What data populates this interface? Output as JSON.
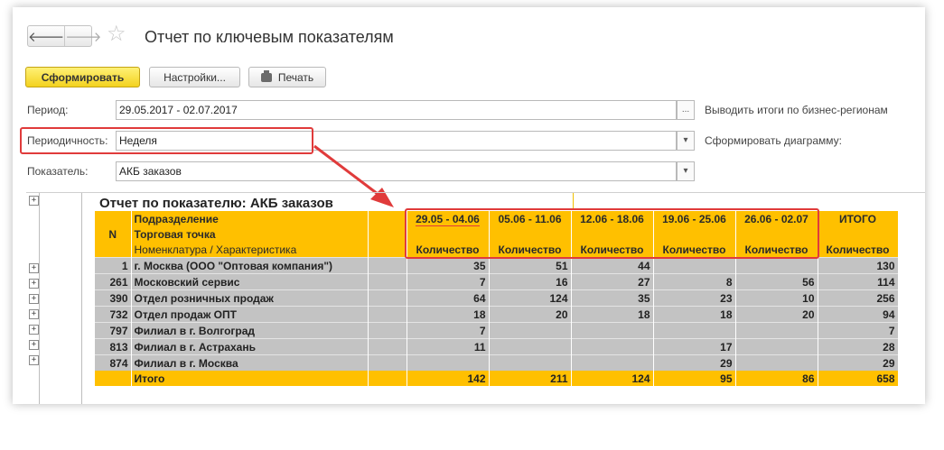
{
  "window": {
    "title": "Отчет по ключевым показателям",
    "nav": {
      "back": "🡐",
      "forward": "🡒"
    },
    "star": "☆"
  },
  "toolbar": {
    "generate_label": "Сформировать",
    "settings_label": "Настройки...",
    "print_label": "Печать"
  },
  "form": {
    "period_label": "Период:",
    "period_value": "29.05.2017 - 02.07.2017",
    "period_btn": "...",
    "periodicity_label": "Периодичность:",
    "periodicity_value": "Неделя",
    "indicator_label": "Показатель:",
    "indicator_value": "АКБ заказов",
    "dropdown_glyph": "▾",
    "side_option_1": "Выводить итоги по бизнес-регионам",
    "side_option_2": "Сформировать диаграмму:"
  },
  "report": {
    "title": "Отчет по показателю: АКБ заказов",
    "expand_glyph": "+",
    "header": {
      "n": "N",
      "level1": "Подразделение",
      "level2": "Торговая точка",
      "level3": "Номенклатура / Характеристика",
      "periods": [
        "29.05 - 04.06",
        "05.06 - 11.06",
        "12.06 - 18.06",
        "19.06 - 25.06",
        "26.06 - 02.07"
      ],
      "total": "ИТОГО",
      "qty": "Количество"
    },
    "rows": [
      {
        "n": "1",
        "name": "г. Москва  (ООО \"Оптовая компания\")",
        "v": [
          "35",
          "51",
          "44",
          "",
          ""
        ],
        "total": "130"
      },
      {
        "n": "261",
        "name": "Московский сервис",
        "v": [
          "7",
          "16",
          "27",
          "8",
          "56"
        ],
        "total": "114"
      },
      {
        "n": "390",
        "name": "Отдел розничных продаж",
        "v": [
          "64",
          "124",
          "35",
          "23",
          "10"
        ],
        "total": "256"
      },
      {
        "n": "732",
        "name": "Отдел продаж ОПТ",
        "v": [
          "18",
          "20",
          "18",
          "18",
          "20"
        ],
        "total": "94"
      },
      {
        "n": "797",
        "name": "Филиал в г. Волгоград",
        "v": [
          "7",
          "",
          "",
          "",
          ""
        ],
        "total": "7"
      },
      {
        "n": "813",
        "name": "Филиал в г. Астрахань",
        "v": [
          "11",
          "",
          "",
          "17",
          ""
        ],
        "total": "28"
      },
      {
        "n": "874",
        "name": "Филиал в г. Москва",
        "v": [
          "",
          "",
          "",
          "29",
          ""
        ],
        "total": "29"
      }
    ],
    "totals": {
      "label": "Итого",
      "v": [
        "142",
        "211",
        "124",
        "95",
        "86"
      ],
      "total": "658"
    }
  },
  "colors": {
    "accent_yellow": "#ffc000",
    "data_grey": "#c3c3c3",
    "highlight_red": "#e03b3b"
  }
}
